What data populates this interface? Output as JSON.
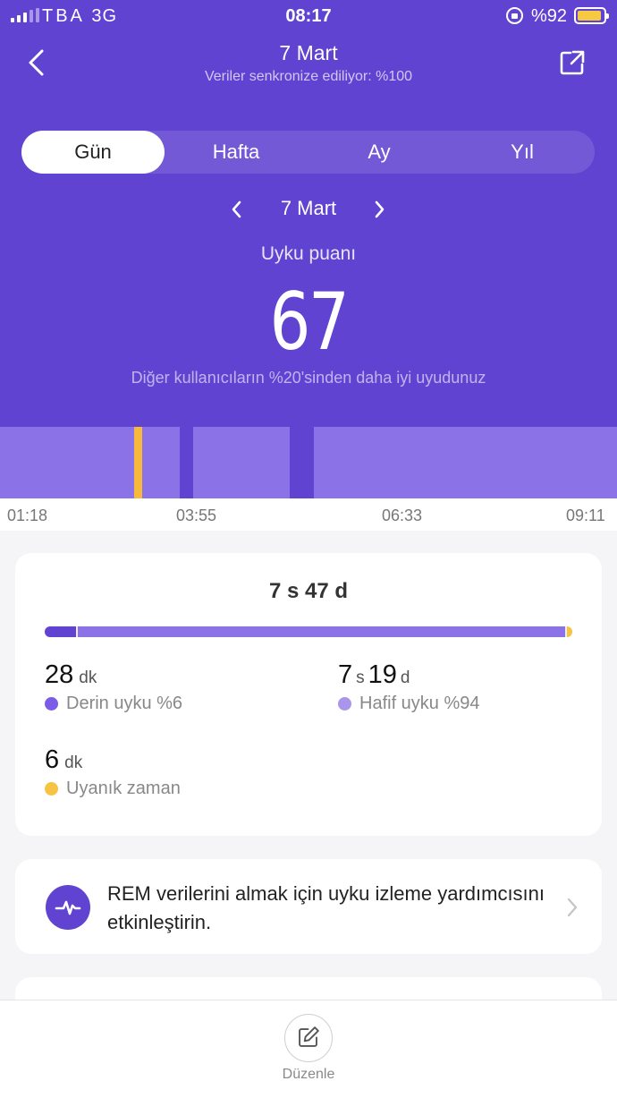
{
  "status_bar": {
    "carrier": "TBA",
    "network": "3G",
    "time": "08:17",
    "battery_text": "%92",
    "battery_level": 0.92
  },
  "header": {
    "title": "7 Mart",
    "subtitle": "Veriler senkronize ediliyor: %100"
  },
  "tabs": [
    {
      "label": "Gün",
      "active": true
    },
    {
      "label": "Hafta",
      "active": false
    },
    {
      "label": "Ay",
      "active": false
    },
    {
      "label": "Yıl",
      "active": false
    }
  ],
  "date_nav": {
    "label": "7 Mart"
  },
  "score": {
    "label": "Uyku puanı",
    "value": "67",
    "note": "Diğer kullanıcıların %20'sinden daha iyi uyudunuz"
  },
  "timeline": {
    "ticks": [
      "01:18",
      "03:55",
      "06:33",
      "09:11"
    ],
    "colors": {
      "light": "#8b72e6",
      "deep": "#6143d2",
      "awake": "#f6b93b"
    }
  },
  "summary": {
    "duration_h": "7",
    "duration_h_unit": "s",
    "duration_m": "47",
    "duration_m_unit": "d",
    "breakdown": {
      "deep_pct": 6,
      "light_pct": 94,
      "awake_pct": 1
    },
    "deep": {
      "value": "28",
      "unit": "dk",
      "label": "Derin uyku %6",
      "color": "#7b5ce8"
    },
    "light": {
      "value_h": "7",
      "unit_h": "s",
      "value_m": "19",
      "unit_m": "d",
      "label": "Hafif uyku %94",
      "color": "#a995ea"
    },
    "awake": {
      "value": "6",
      "unit": "dk",
      "label": "Uyanık zaman",
      "color": "#f6c343"
    }
  },
  "rem_card": {
    "text": "REM verilerini almak için uyku izleme yardımcısını etkinleştirin."
  },
  "bottom": {
    "edit_label": "Düzenle"
  }
}
